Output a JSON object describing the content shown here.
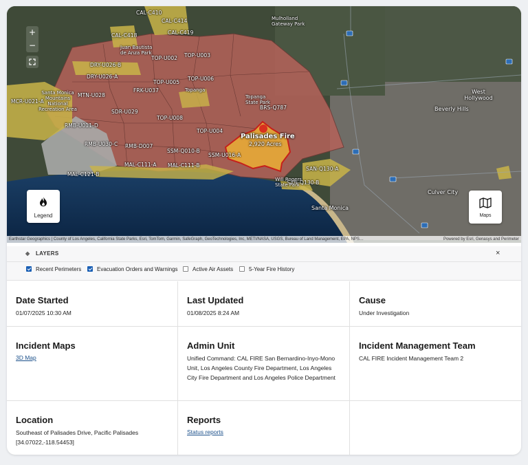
{
  "map": {
    "zoom_in": "+",
    "zoom_out": "−",
    "legend_label": "Legend",
    "maps_label": "Maps",
    "attribution": "Earthstar Geographics | County of Los Angeles, California State Parks, Esri, TomTom, Garmin, SafeGraph, GeoTechnologies, Inc, METI/NASA, USGS, Bureau of Land Management, EPA, NPS…",
    "attribution_right": "Powered by Esri, Genasys and Perimeter",
    "fire": {
      "name": "Palisades Fire",
      "acres": "2,920 Acres"
    },
    "places": {
      "santa_monica": "Santa Monica",
      "west_hollywood": "West Hollywood",
      "beverly_hills": "Beverly Hills",
      "culver_city": "Culver City",
      "topanga": "Topanga",
      "topanga_park": "Topanga State Park",
      "mulholland": "Mulholland Gateway Park",
      "smmnra": "Santa Monica Mountains National Recreation Area",
      "will_rogers": "Will Rogers State Park",
      "juan_bautista": "Juan Bautista de Anza Park"
    },
    "zones": [
      "CAL-C410",
      "CAL-C414",
      "CAL-C419",
      "CAL-C418",
      "DRY-U026-B",
      "DRY-U026-A",
      "MTN-U028",
      "FRK-U037",
      "TOP-U002",
      "TOP-U003",
      "TOP-U005",
      "TOP-U006",
      "MCR-U021-A",
      "RMB-U011-D",
      "SDR-U029",
      "TOP-U008",
      "TOP-U004",
      "BRS-Q787",
      "RMB-U030-C",
      "RMB-D007",
      "SSM-Q010-B",
      "SSM-U016-A",
      "MAL-C111-A",
      "MAL-C111-B",
      "MAL-C121-B",
      "SAN-Q130-A",
      "SAN-Q130-B"
    ]
  },
  "layers": {
    "title": "LAYERS",
    "close": "×",
    "options": [
      {
        "label": "Recent Perimeters",
        "checked": true
      },
      {
        "label": "Evacuation Orders and Warnings",
        "checked": true
      },
      {
        "label": "Active Air Assets",
        "checked": false
      },
      {
        "label": "5-Year Fire History",
        "checked": false
      }
    ]
  },
  "details": {
    "date_started": {
      "heading": "Date Started",
      "value": "01/07/2025 10:30 AM"
    },
    "last_updated": {
      "heading": "Last Updated",
      "value": "01/08/2025 8:24 AM"
    },
    "cause": {
      "heading": "Cause",
      "value": "Under Investigation"
    },
    "incident_maps": {
      "heading": "Incident Maps",
      "link": "3D Map"
    },
    "admin_unit": {
      "heading": "Admin Unit",
      "value": "Unified Command: CAL FIRE San Bernardino-Inyo-Mono Unit, Los Angeles County Fire Department, Los Angeles City Fire Department and Los Angeles Police Department"
    },
    "imt": {
      "heading": "Incident Management Team",
      "value": "CAL FIRE Incident Management Team 2"
    },
    "location": {
      "heading": "Location",
      "value": "Southeast of Palisades Drive, Pacific Palisades",
      "coords": "[34.07022,-118.54453]"
    },
    "reports": {
      "heading": "Reports",
      "link": "Status reports"
    }
  },
  "colors": {
    "evac_order": "#b5625a",
    "evac_warning": "#c9b449",
    "fire_perimeter": "#e0a23a",
    "ocean": "#0e2a4a"
  }
}
